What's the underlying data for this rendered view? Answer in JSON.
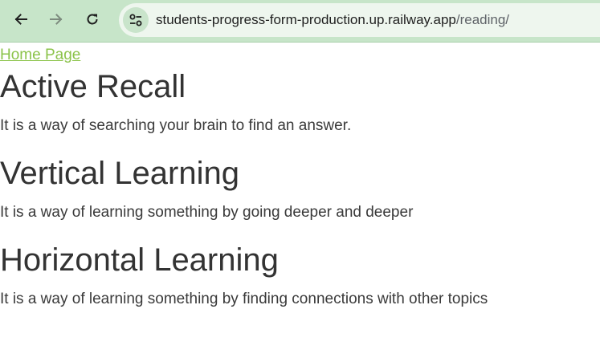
{
  "browser": {
    "url_host": "students-progress-form-production.up.railway.app",
    "url_path": "/reading/",
    "back_icon": "arrow-left-icon",
    "forward_icon": "arrow-right-icon",
    "reload_icon": "reload-icon",
    "site_info_icon": "tune-icon",
    "bar_color": "#c7e5c9"
  },
  "page": {
    "home_link": "Home Page",
    "link_color": "#8bc34a",
    "sections": [
      {
        "title": "Active Recall",
        "description": "It is a way of searching your brain to find an answer."
      },
      {
        "title": "Vertical Learning",
        "description": "It is a way of learning something by going deeper and deeper"
      },
      {
        "title": "Horizontal Learning",
        "description": "It is a way of learning something by finding connections with other topics"
      }
    ]
  }
}
